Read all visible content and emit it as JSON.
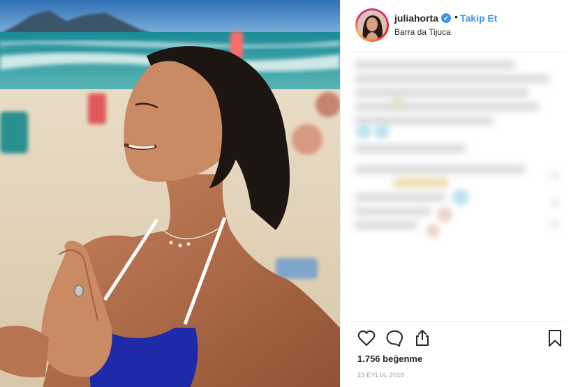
{
  "post": {
    "photo_label": "beach-yoga-photo"
  },
  "header": {
    "username": "juliahorta",
    "verified_symbol": "✔",
    "separator": "•",
    "follow_label": "Takip Et",
    "location": "Barra da Tijuca"
  },
  "actions": {
    "icons": [
      "heart-icon",
      "comment-icon",
      "share-icon",
      "bookmark-icon"
    ]
  },
  "stats": {
    "likes": "1.756 beğenme",
    "date": "23 EYLÜL 2018"
  },
  "colors": {
    "accent": "#3897f0",
    "text": "#262626",
    "muted": "#999999",
    "divider": "#efefef"
  }
}
